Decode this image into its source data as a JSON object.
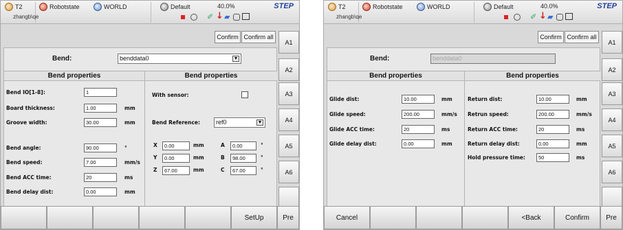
{
  "left": {
    "topbar": {
      "t2": "T2",
      "robotstate": "Robotstate",
      "world": "WORLD",
      "tool": "Default",
      "speed": "40.0%",
      "mode": "STEP",
      "path": "zhangb\\qe"
    },
    "confirm": {
      "confirm": "Confirm",
      "confirm_all": "Confirm all"
    },
    "side": [
      "A1",
      "A2",
      "A3",
      "A4",
      "A5",
      "A6"
    ],
    "bend": {
      "label": "Bend:",
      "value": "benddata0"
    },
    "left_props": {
      "title": "Bend properties",
      "fields": [
        {
          "label": "Bend IO[1-8]:",
          "value": "1",
          "unit": ""
        },
        {
          "label": "Board thickness:",
          "value": "1.00",
          "unit": "mm"
        },
        {
          "label": "Groove width:",
          "value": "30.00",
          "unit": "mm"
        },
        {
          "label": "Bend angle:",
          "value": "90.00",
          "unit": "°"
        },
        {
          "label": "Bend speed:",
          "value": "7.00",
          "unit": "mm/s"
        },
        {
          "label": "Bend ACC time:",
          "value": "20",
          "unit": "ms"
        },
        {
          "label": "Bend delay dist:",
          "value": "0.00",
          "unit": "mm"
        }
      ]
    },
    "right_props": {
      "title": "Bend properties",
      "with_sensor": "With sensor:",
      "bend_reference": "Bend Reference:",
      "reference_value": "ref0",
      "coords": [
        {
          "axis": "X",
          "value": "0.00",
          "unit": "mm",
          "axis2": "A",
          "value2": "0.00",
          "unit2": "°"
        },
        {
          "axis": "Y",
          "value": "0.00",
          "unit": "mm",
          "axis2": "B",
          "value2": "98.00",
          "unit2": "°"
        },
        {
          "axis": "Z",
          "value": "67.00",
          "unit": "mm",
          "axis2": "C",
          "value2": "67.00",
          "unit2": "°"
        }
      ]
    },
    "bottom": {
      "setup": "SetUp",
      "pre": "Pre"
    }
  },
  "right": {
    "topbar": {
      "t2": "T2",
      "robotstate": "Robotstate",
      "world": "WORLD",
      "tool": "Default",
      "speed": "40.0%",
      "mode": "STEP",
      "path": "zhangb\\qe"
    },
    "confirm": {
      "confirm": "Confirm",
      "confirm_all": "Confirm all"
    },
    "side": [
      "A1",
      "A2",
      "A3",
      "A4",
      "A5",
      "A6"
    ],
    "bend": {
      "label": "Bend:",
      "value": "benddata0"
    },
    "left_props": {
      "title": "Bend properties",
      "fields": [
        {
          "label": "Glide dist:",
          "value": "10.00",
          "unit": "mm"
        },
        {
          "label": "Glide speed:",
          "value": "200.00",
          "unit": "mm/s"
        },
        {
          "label": "Glide ACC time:",
          "value": "20",
          "unit": "ms"
        },
        {
          "label": "Glide delay dist:",
          "value": "0.00",
          "unit": "mm"
        }
      ]
    },
    "right_props": {
      "title": "Bend properties",
      "fields": [
        {
          "label": "Return dist:",
          "value": "10.00",
          "unit": "mm"
        },
        {
          "label": "Retrun speed:",
          "value": "200.00",
          "unit": "mm/s"
        },
        {
          "label": "Return ACC time:",
          "value": "20",
          "unit": "ms"
        },
        {
          "label": "Return delay dist:",
          "value": "0.00",
          "unit": "mm"
        },
        {
          "label": "Hold pressure time:",
          "value": "50",
          "unit": "ms"
        }
      ]
    },
    "bottom": {
      "cancel": "Cancel",
      "back": "<Back",
      "confirm": "Confirm",
      "pre": "Pre"
    }
  }
}
